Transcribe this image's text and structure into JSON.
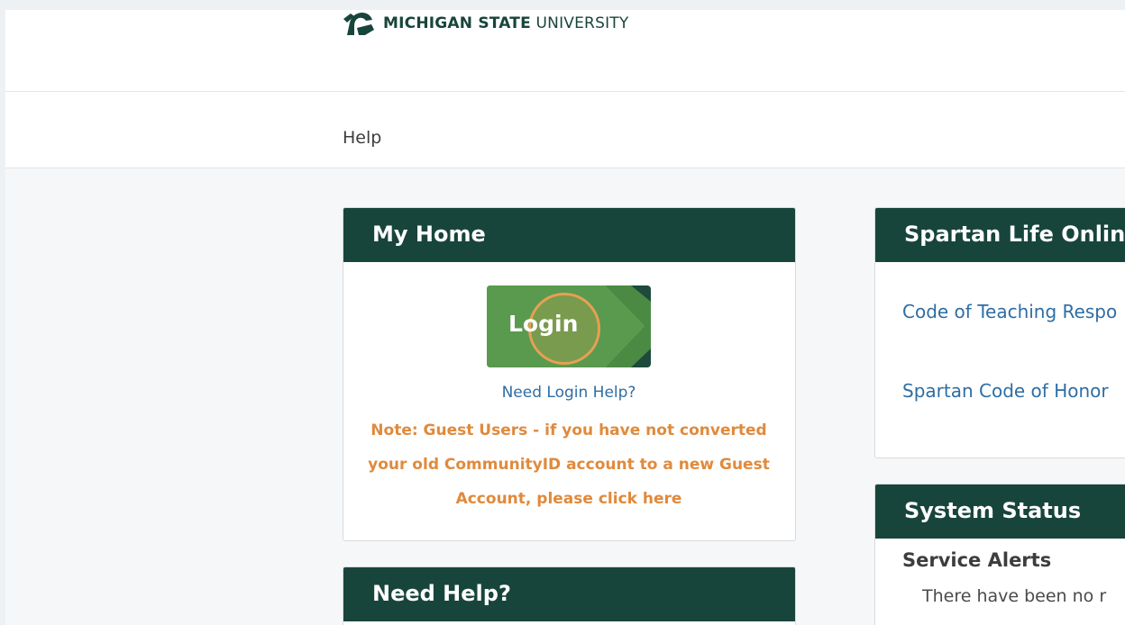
{
  "header": {
    "logo": {
      "bold": "MICHIGAN STATE",
      "light": "UNIVERSITY"
    }
  },
  "nav": {
    "help": "Help"
  },
  "my_home": {
    "title": "My Home",
    "login_label": "Login",
    "need_login_help": "Need Login Help?",
    "guest_note": "Note: Guest Users - if you have not converted your old CommunityID account to a new Guest Account, please click here"
  },
  "spartan_life": {
    "title": "Spartan Life Onlin",
    "links": [
      "Code of Teaching Respo",
      "Spartan Code of Honor"
    ]
  },
  "need_help": {
    "title": "Need Help?"
  },
  "system_status": {
    "title": "System Status",
    "alerts_title": "Service Alerts",
    "alerts_text": "There have been no r"
  },
  "colors": {
    "brand_green": "#18453b",
    "login_green": "#5a9a4e",
    "link_blue": "#2e6da4",
    "note_orange": "#e08a3c"
  },
  "icons": {
    "logo_mark": "spartan-helmet-icon",
    "login_arrow": "chevron-arrow-icon"
  }
}
